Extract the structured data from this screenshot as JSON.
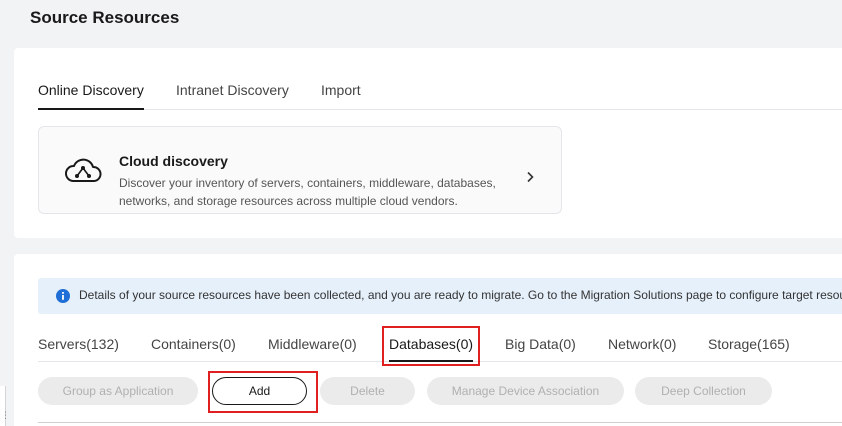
{
  "page": {
    "title": "Source Resources"
  },
  "discovery_tabs": [
    {
      "label": "Online Discovery",
      "active": true
    },
    {
      "label": "Intranet Discovery",
      "active": false
    },
    {
      "label": "Import",
      "active": false
    }
  ],
  "cloud_discovery": {
    "title": "Cloud discovery",
    "description": "Discover your inventory of servers, containers, middleware, databases, networks, and storage resources across multiple cloud vendors.",
    "icon": "cloud-network-icon"
  },
  "info_banner": {
    "text": "Details of your source resources have been collected, and you are ready to migrate. Go to the Migration Solutions page to configure target resources."
  },
  "resource_tabs": [
    {
      "label": "Servers(132)",
      "active": false
    },
    {
      "label": "Containers(0)",
      "active": false
    },
    {
      "label": "Middleware(0)",
      "active": false
    },
    {
      "label": "Databases(0)",
      "active": true
    },
    {
      "label": "Big Data(0)",
      "active": false
    },
    {
      "label": "Network(0)",
      "active": false
    },
    {
      "label": "Storage(165)",
      "active": false
    }
  ],
  "toolbar": {
    "group_label": "Group as Application",
    "add_label": "Add",
    "delete_label": "Delete",
    "manage_label": "Manage Device Association",
    "deep_label": "Deep Collection"
  },
  "colors": {
    "highlight": "#e02020",
    "info_bg": "#e6f0fb",
    "info_icon": "#1f6fd6"
  }
}
